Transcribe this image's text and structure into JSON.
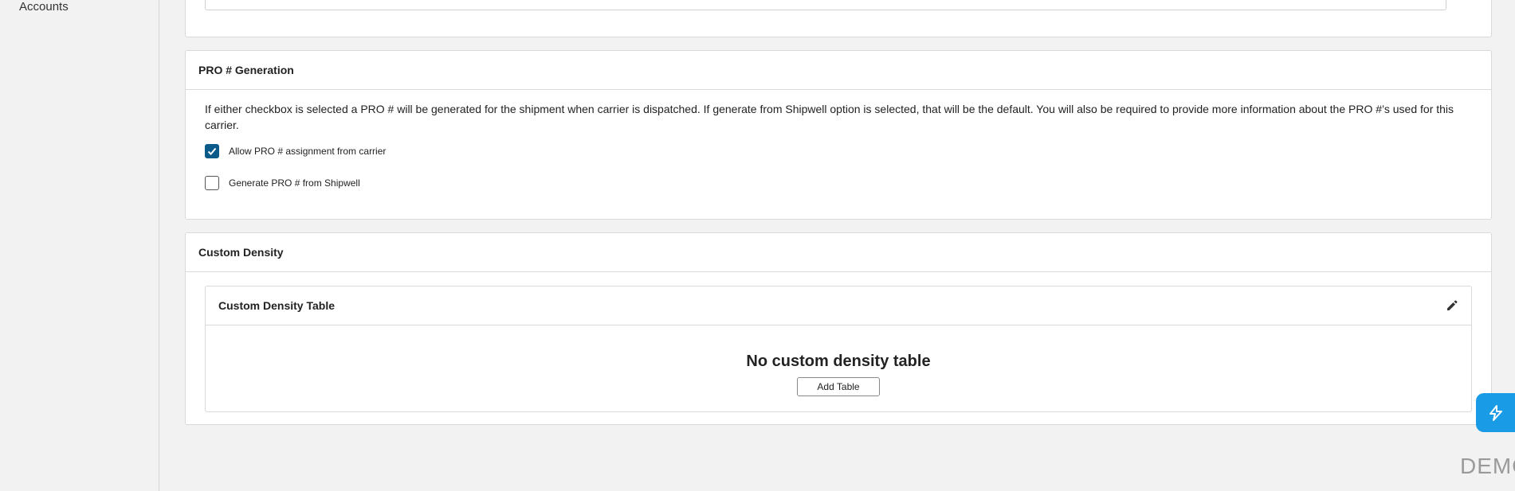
{
  "sidebar": {
    "items": [
      {
        "label": "Accounts"
      }
    ]
  },
  "pro_generation": {
    "title": "PRO # Generation",
    "description": "If either checkbox is selected a PRO # will be generated for the shipment when carrier is dispatched. If generate from Shipwell option is selected, that will be the default. You will also be required to provide more information about the PRO #’s used for this carrier.",
    "options": [
      {
        "label": "Allow PRO # assignment from carrier",
        "checked": true
      },
      {
        "label": "Generate PRO # from Shipwell",
        "checked": false
      }
    ]
  },
  "custom_density": {
    "title": "Custom Density",
    "table_title": "Custom Density Table",
    "empty_text": "No custom density table",
    "add_button": "Add Table"
  },
  "watermark": "DEMO",
  "colors": {
    "accent": "#0a5a8a",
    "fab": "#1a9be6"
  },
  "icons": {
    "edit": "pencil-icon",
    "fab": "shipwell-bolt-icon",
    "check": "check-icon"
  }
}
